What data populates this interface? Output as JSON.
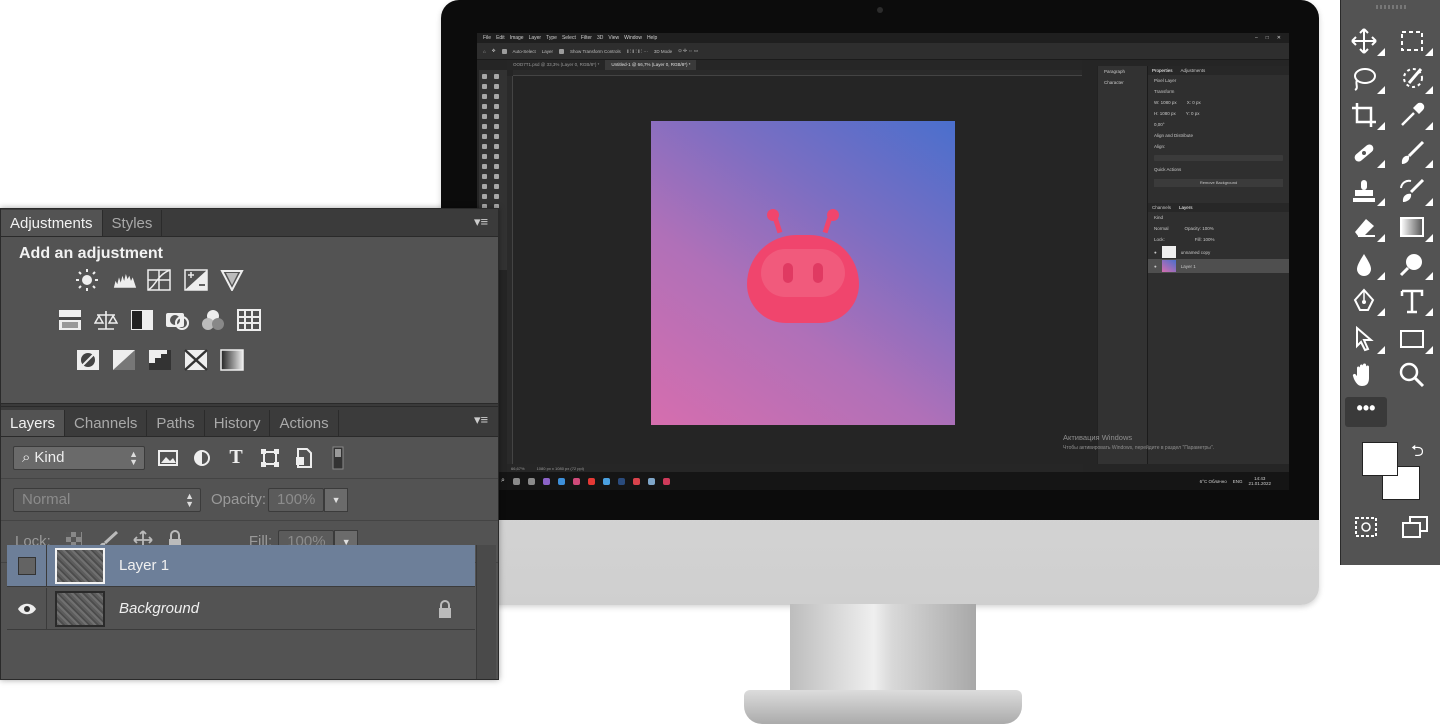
{
  "screen": {
    "menus": [
      "File",
      "Edit",
      "Image",
      "Layer",
      "Type",
      "Select",
      "Filter",
      "3D",
      "View",
      "Window",
      "Help"
    ],
    "options": {
      "auto_select": "Auto-Select",
      "layer": "Layer",
      "show_transform": "Show Transform Controls",
      "mode_3d": "3D Mode"
    },
    "doc_tabs": [
      "OOD7T1.psd @ 33,3% (Layer 0, RGB/8*) *",
      "Untitled-1 @ 66,7% (Layer 0, RGB/8*) *"
    ],
    "status": {
      "zoom": "66,67%",
      "size": "1080 px x 1080 px (72 ppi)"
    },
    "mid_panel": [
      "Paragraph",
      "Character"
    ],
    "properties": {
      "tabs": [
        "Properties",
        "Adjustments"
      ],
      "kind": "Pixel Layer",
      "transform": "Transform",
      "w": "W: 1080 px",
      "h": "H: 1080 px",
      "x": "X: 0 px",
      "y": "Y: 0 px",
      "angle": "0,00°",
      "align": "Align and Distribute",
      "align_sub": "Align:",
      "quick": "Quick Actions",
      "remove_bg": "Remove Background"
    },
    "layers_mini": {
      "tabs": [
        "Channels",
        "Layers"
      ],
      "kind": "Kind",
      "mode": "Normal",
      "opacity": "Opacity: 100%",
      "lock": "Lock:",
      "fill": "Fill: 100%",
      "rows": [
        "unnamed copy",
        "Layer 1"
      ]
    },
    "activate": {
      "title": "Активация Windows",
      "text": "Чтобы активировать Windows, перейдите в раздел \"Параметры\"."
    },
    "taskbar": {
      "weather": "6°C  Облачно",
      "lang": "ENG",
      "time": "14:43",
      "date": "21.01.2022"
    }
  },
  "adjustments": {
    "tabs": [
      "Adjustments",
      "Styles"
    ],
    "title": "Add an adjustment",
    "icons": [
      "brightness-contrast",
      "levels",
      "curves",
      "exposure",
      "vibrance",
      "hue-saturation",
      "color-balance",
      "black-white",
      "photo-filter",
      "channel-mixer",
      "color-lookup",
      "invert",
      "posterize",
      "threshold",
      "selective-color",
      "gradient-map"
    ]
  },
  "layers": {
    "tabs": [
      "Layers",
      "Channels",
      "Paths",
      "History",
      "Actions"
    ],
    "kind": "Kind",
    "blend_mode": "Normal",
    "opacity_label": "Opacity:",
    "opacity_value": "100%",
    "lock_label": "Lock:",
    "fill_label": "Fill:",
    "fill_value": "100%",
    "rows": [
      {
        "name": "Layer 1",
        "selected": true,
        "visible": false
      },
      {
        "name": "Background",
        "selected": false,
        "visible": true,
        "locked": true
      }
    ]
  },
  "toolbar": {
    "tools": [
      "move",
      "marquee",
      "lasso",
      "quick-selection",
      "crop",
      "eyedropper",
      "healing",
      "brush",
      "stamp",
      "history-brush",
      "eraser",
      "gradient",
      "blur",
      "dodge",
      "pen",
      "type",
      "path-selection",
      "rectangle",
      "hand",
      "zoom"
    ],
    "more": "•••",
    "foreground": "#ffffff",
    "background": "#ffffff"
  }
}
